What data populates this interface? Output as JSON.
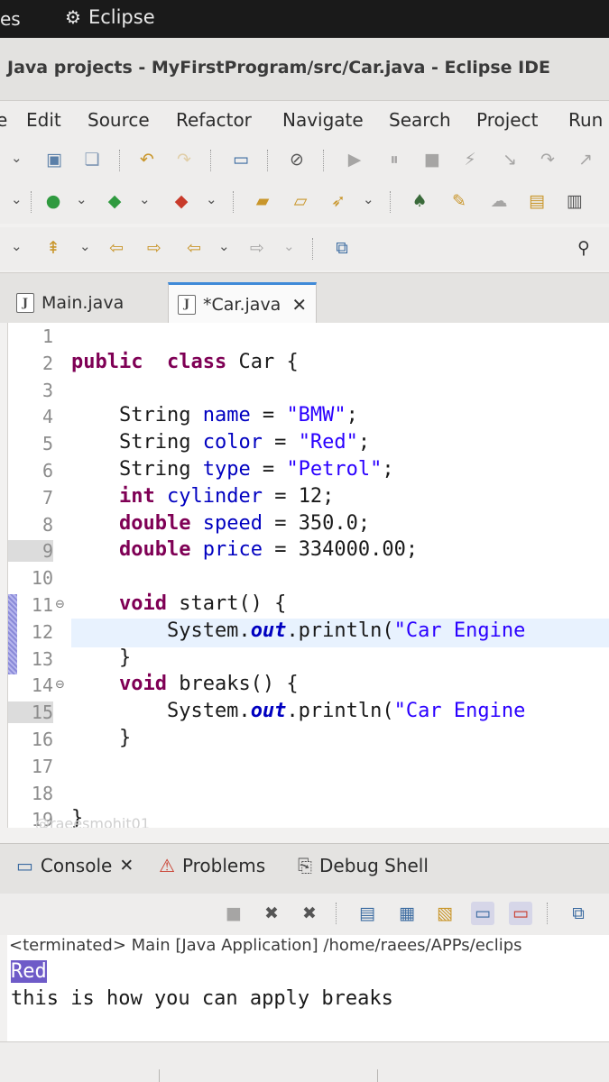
{
  "system_bar": {
    "apps_label": "es",
    "app_name": "Eclipse"
  },
  "window": {
    "title": "Java projects - MyFirstProgram/src/Car.java - Eclipse IDE"
  },
  "menu": [
    "e",
    "Edit",
    "Source",
    "Refactor",
    "Navigate",
    "Search",
    "Project",
    "Run"
  ],
  "editor_tabs": [
    {
      "label": "Main.java",
      "active": false
    },
    {
      "label": "*Car.java",
      "active": true
    }
  ],
  "editor": {
    "line_numbers": [
      "1",
      "2",
      "3",
      "4",
      "5",
      "6",
      "7",
      "8",
      "9",
      "10",
      "11",
      "12",
      "13",
      "14",
      "15",
      "16",
      "17",
      "18",
      "19"
    ],
    "lines": [
      [],
      [
        [
          "kw",
          "public"
        ],
        [
          "",
          "  "
        ],
        [
          "kw",
          "class"
        ],
        [
          "",
          " Car {"
        ]
      ],
      [],
      [
        [
          "",
          "    String "
        ],
        [
          "fld",
          "name"
        ],
        [
          "",
          " = "
        ],
        [
          "str",
          "\"BMW\""
        ],
        [
          "",
          ";"
        ]
      ],
      [
        [
          "",
          "    String "
        ],
        [
          "fld",
          "color"
        ],
        [
          "",
          " = "
        ],
        [
          "str",
          "\"Red\""
        ],
        [
          "",
          ";"
        ]
      ],
      [
        [
          "",
          "    String "
        ],
        [
          "fld",
          "type"
        ],
        [
          "",
          " = "
        ],
        [
          "str",
          "\"Petrol\""
        ],
        [
          "",
          ";"
        ]
      ],
      [
        [
          "",
          "    "
        ],
        [
          "kw",
          "int"
        ],
        [
          "",
          " "
        ],
        [
          "fld",
          "cylinder"
        ],
        [
          "",
          " = 12;"
        ]
      ],
      [
        [
          "",
          "    "
        ],
        [
          "kw",
          "double"
        ],
        [
          "",
          " "
        ],
        [
          "fld",
          "speed"
        ],
        [
          "",
          " = 350.0;"
        ]
      ],
      [
        [
          "",
          "    "
        ],
        [
          "kw",
          "double"
        ],
        [
          "",
          " "
        ],
        [
          "fld",
          "price"
        ],
        [
          "",
          " = 334000.00;"
        ]
      ],
      [],
      [
        [
          "",
          "    "
        ],
        [
          "kw",
          "void"
        ],
        [
          "",
          " start() {"
        ]
      ],
      [
        [
          "",
          "        System."
        ],
        [
          "st",
          "out"
        ],
        [
          "",
          ".println("
        ],
        [
          "str",
          "\"Car Engine"
        ]
      ],
      [
        [
          "",
          "    }"
        ]
      ],
      [
        [
          "",
          "    "
        ],
        [
          "kw",
          "void"
        ],
        [
          "",
          " breaks() {"
        ]
      ],
      [
        [
          "",
          "        System."
        ],
        [
          "st",
          "out"
        ],
        [
          "",
          ".println("
        ],
        [
          "str",
          "\"Car Engine"
        ]
      ],
      [
        [
          "",
          "    }"
        ]
      ],
      [],
      [],
      [
        [
          "",
          "}"
        ]
      ]
    ],
    "watermark": "@raeesmohit01"
  },
  "console_tabs": [
    {
      "label": "Console",
      "closable": true
    },
    {
      "label": "Problems",
      "closable": false
    },
    {
      "label": "Debug Shell",
      "closable": false
    }
  ],
  "console": {
    "path": "<terminated> Main [Java Application] /home/raees/APPs/eclips",
    "output": [
      "Red",
      "this is how you can apply breaks"
    ]
  },
  "colors": {
    "keyword": "#7f0055",
    "field": "#0000c0",
    "string": "#2a00ff",
    "active_tab_accent": "#3f8ad8",
    "selection": "#6e5bc8"
  }
}
